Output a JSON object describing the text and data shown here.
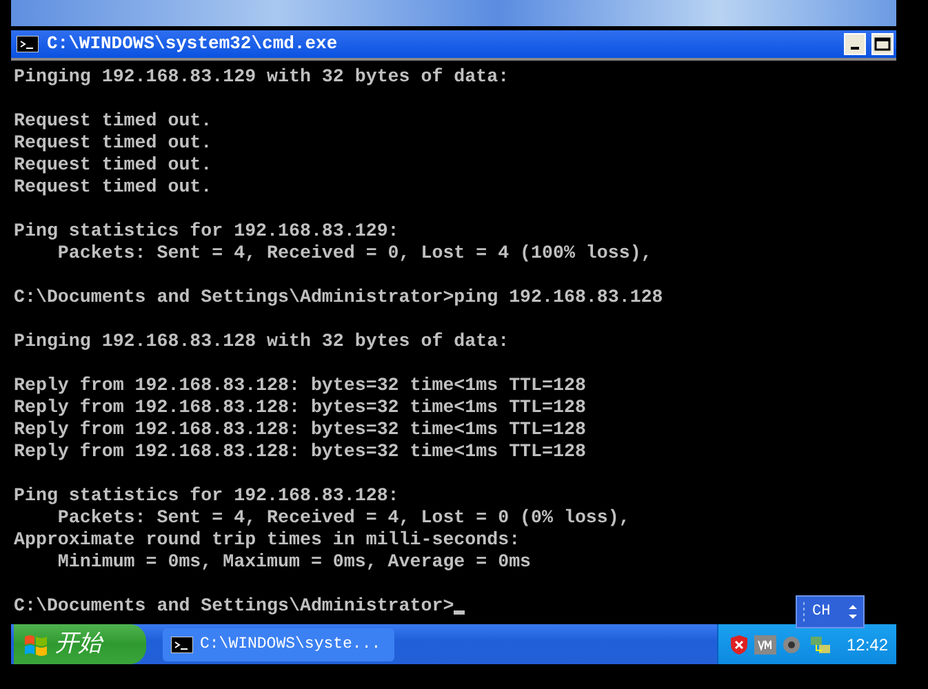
{
  "window": {
    "title": "C:\\WINDOWS\\system32\\cmd.exe"
  },
  "console": {
    "blocks": [
      [
        "Pinging 192.168.83.129 with 32 bytes of data:"
      ],
      [
        "Request timed out.",
        "Request timed out.",
        "Request timed out.",
        "Request timed out."
      ],
      [
        "Ping statistics for 192.168.83.129:",
        "    Packets: Sent = 4, Received = 0, Lost = 4 (100% loss),"
      ],
      [
        "C:\\Documents and Settings\\Administrator>ping 192.168.83.128"
      ],
      [
        "Pinging 192.168.83.128 with 32 bytes of data:"
      ],
      [
        "Reply from 192.168.83.128: bytes=32 time<1ms TTL=128",
        "Reply from 192.168.83.128: bytes=32 time<1ms TTL=128",
        "Reply from 192.168.83.128: bytes=32 time<1ms TTL=128",
        "Reply from 192.168.83.128: bytes=32 time<1ms TTL=128"
      ],
      [
        "Ping statistics for 192.168.83.128:",
        "    Packets: Sent = 4, Received = 4, Lost = 0 (0% loss),",
        "Approximate round trip times in milli-seconds:",
        "    Minimum = 0ms, Maximum = 0ms, Average = 0ms"
      ]
    ],
    "prompt": "C:\\Documents and Settings\\Administrator>"
  },
  "language_bar": {
    "label": "CH"
  },
  "taskbar": {
    "start_label": "开始",
    "tasks": [
      {
        "label": "C:\\WINDOWS\\syste...",
        "selected": false
      }
    ],
    "clock": "12:42"
  }
}
